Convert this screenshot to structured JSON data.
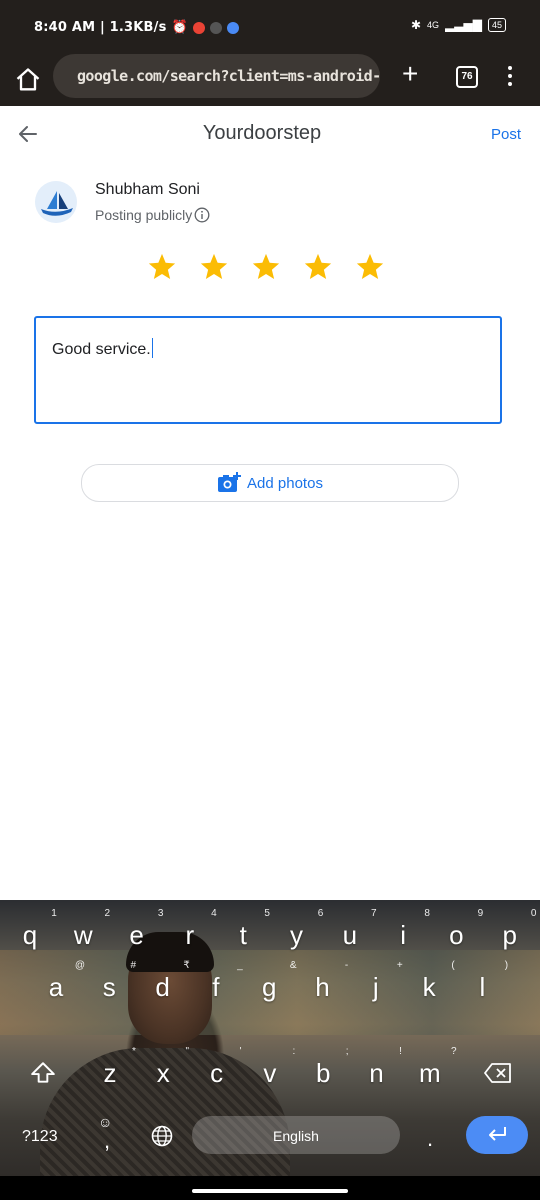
{
  "status_bar": {
    "time": "8:40 AM | 1.3KB/s",
    "network": "4G",
    "battery": "45"
  },
  "browser": {
    "url": "google.com/search?client=ms-android-xiaomi",
    "tab_count": "76"
  },
  "header": {
    "title": "Yourdoorstep",
    "post_label": "Post"
  },
  "user": {
    "name": "Shubham Soni",
    "posting_status": "Posting publicly"
  },
  "rating": {
    "value": 5,
    "max": 5,
    "color": "#fbbc04"
  },
  "review": {
    "text": "Good service."
  },
  "add_photos_label": "Add photos",
  "keyboard": {
    "row1": [
      "q",
      "w",
      "e",
      "r",
      "t",
      "y",
      "u",
      "i",
      "o",
      "p"
    ],
    "row1_hints": [
      "1",
      "2",
      "3",
      "4",
      "5",
      "6",
      "7",
      "8",
      "9",
      "0"
    ],
    "row2": [
      "a",
      "s",
      "d",
      "f",
      "g",
      "h",
      "j",
      "k",
      "l"
    ],
    "row2_hints": [
      "@",
      "#",
      "₹",
      "_",
      "&",
      "-",
      "+",
      "(",
      ")"
    ],
    "row3": [
      "z",
      "x",
      "c",
      "v",
      "b",
      "n",
      "m"
    ],
    "row3_hints": [
      "*",
      "\"",
      "'",
      ":",
      ";",
      "!",
      "?"
    ],
    "symbols_label": "?123",
    "space_label": "English",
    "comma": ",",
    "period": "."
  },
  "colors": {
    "accent": "#1a73e8",
    "chrome_bg": "#231f1c"
  }
}
